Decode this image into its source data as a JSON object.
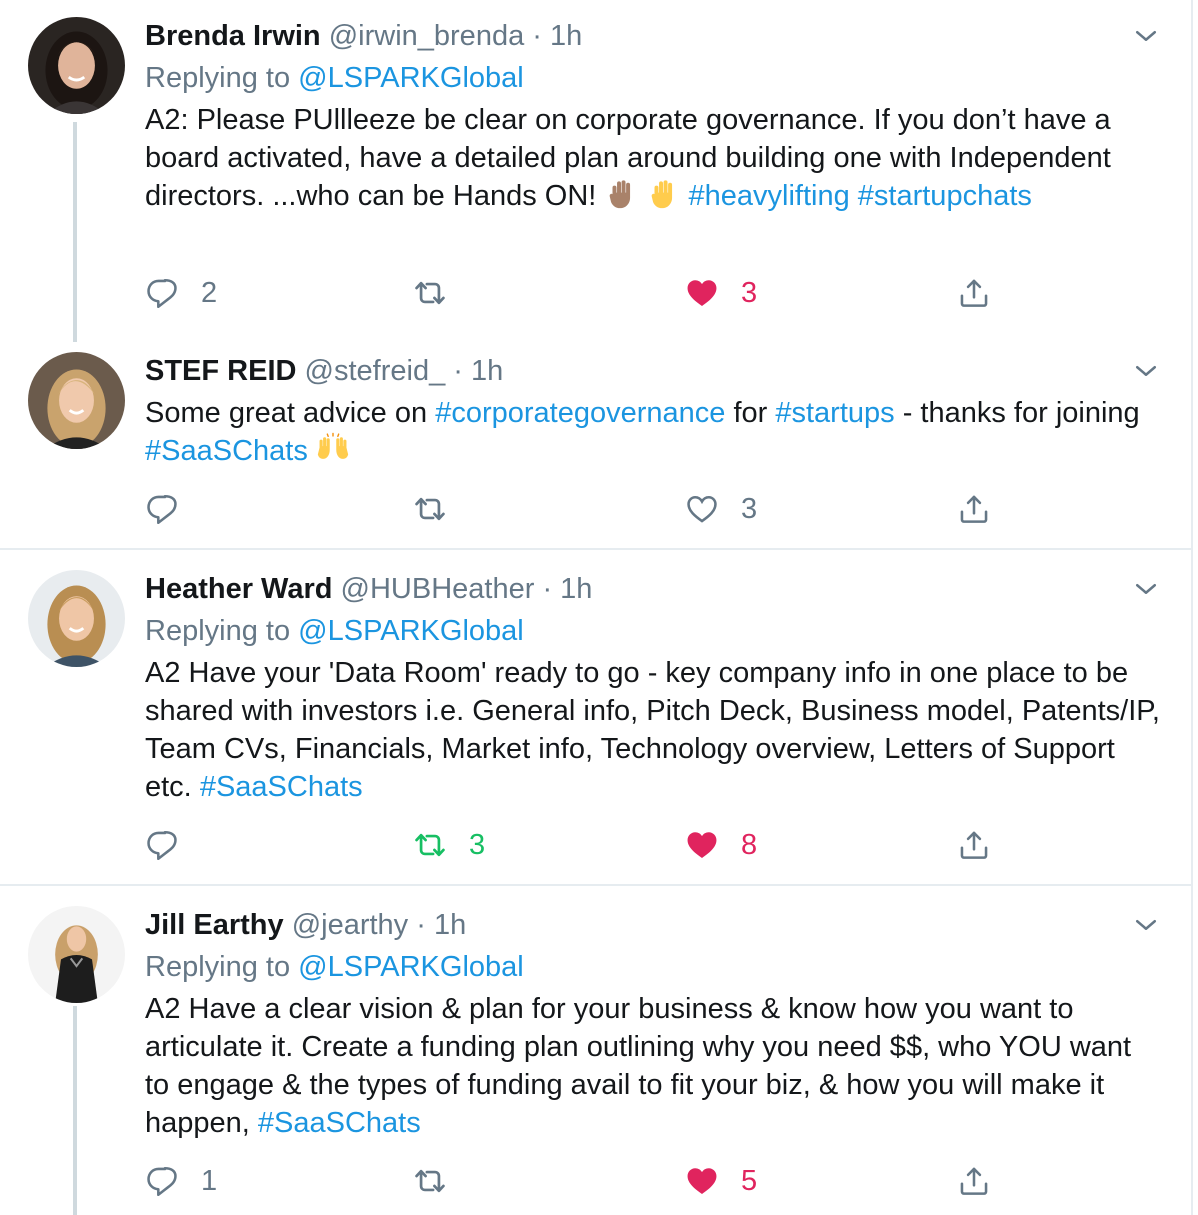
{
  "colors": {
    "link": "#1b95e0",
    "secondary_text": "#657786",
    "like_active": "#e0245e",
    "retweet_active": "#17bf63",
    "separator": "#e6ecf0"
  },
  "tweets": [
    {
      "name": "Brenda Irwin",
      "handle": "@irwin_brenda",
      "separator": "·",
      "time": "1h",
      "replying_label": "Replying to",
      "replying_to": "@LSPARKGlobal",
      "text_parts": [
        "A2: Please PUllleeze be clear on corporate governance. If you don’t have a board activated, have a detailed plan around building one with Independent directors. ...who can be Hands ON!",
        "#heavylifting",
        "#startupchats"
      ],
      "emoji": [
        "raised-hand-medium-skin-tone",
        "raised-hand"
      ],
      "replies": "2",
      "retweets": "",
      "likes": "3",
      "liked": true,
      "retweeted": false
    },
    {
      "name": "STEF REID",
      "handle": "@stefreid_",
      "separator": "·",
      "time": "1h",
      "text_parts": [
        "Some great advice on",
        "#corporategovernance",
        "for",
        "#startups",
        "- thanks for joining",
        "#SaaSChats"
      ],
      "emoji": [
        "raising-hands"
      ],
      "replies": "",
      "retweets": "",
      "likes": "3",
      "liked": false,
      "retweeted": false
    },
    {
      "name": "Heather Ward",
      "handle": "@HUBHeather",
      "separator": "·",
      "time": "1h",
      "replying_label": "Replying to",
      "replying_to": "@LSPARKGlobal",
      "text_parts": [
        "A2 Have your 'Data Room' ready to go - key company info in one place to be shared with investors i.e. General info, Pitch Deck, Business model, Patents/IP, Team CVs, Financials, Market info, Technology overview, Letters of Support etc.",
        "#SaaSChats"
      ],
      "replies": "",
      "retweets": "3",
      "likes": "8",
      "liked": true,
      "retweeted": true
    },
    {
      "name": "Jill Earthy",
      "handle": "@jearthy",
      "separator": "·",
      "time": "1h",
      "replying_label": "Replying to",
      "replying_to": "@LSPARKGlobal",
      "text_parts": [
        "A2 Have a clear vision & plan for your business & know how you want to articulate it. Create a funding plan outlining why you need $$, who YOU want to engage & the types of funding avail to fit your biz, & how you will make it happen,",
        "#SaaSChats"
      ],
      "replies": "1",
      "retweets": "",
      "likes": "5",
      "liked": true,
      "retweeted": false
    }
  ]
}
